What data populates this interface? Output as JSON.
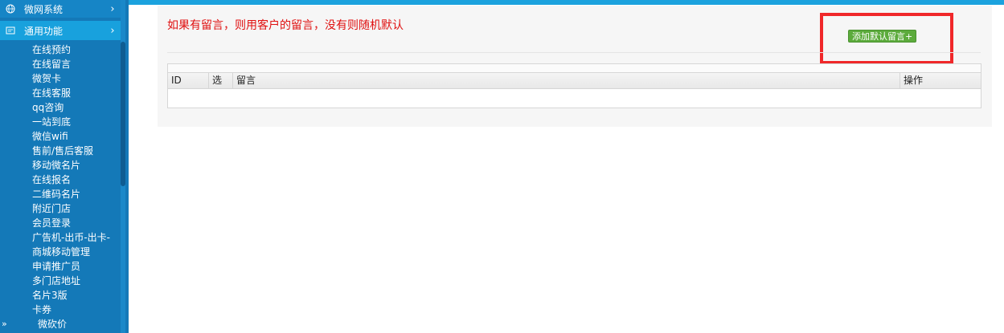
{
  "sidebar": {
    "top_category": {
      "label": "微网系统",
      "icon": "globe-icon",
      "chevron": "›"
    },
    "active_category": {
      "label": "通用功能",
      "icon": "settings-icon",
      "chevron": "›"
    },
    "items": [
      "在线预约",
      "在线留言",
      "微贺卡",
      "在线客服",
      "qq咨询",
      "一站到底",
      "微信wifi",
      "售前/售后客服",
      "移动微名片",
      "在线报名",
      "二维码名片",
      "附近门店",
      "会员登录",
      "广告机-出币-出卡-",
      "商城移动管理",
      "申请推广员",
      "多门店地址",
      "名片3版",
      "卡券",
      "微砍价"
    ],
    "collapse_label": "»"
  },
  "main": {
    "notice": "如果有留言，则用客户的留言，没有则随机默认",
    "add_button": "添加默认留言+",
    "table": {
      "columns": [
        "ID",
        "选",
        "留言",
        "操作"
      ],
      "rows": []
    }
  },
  "colors": {
    "sidebar_bg": "#1479b8",
    "active_bg": "#18a1dd",
    "notice_text": "#e01010",
    "button_bg": "#5cab3c",
    "highlight_border": "#f0282a"
  }
}
